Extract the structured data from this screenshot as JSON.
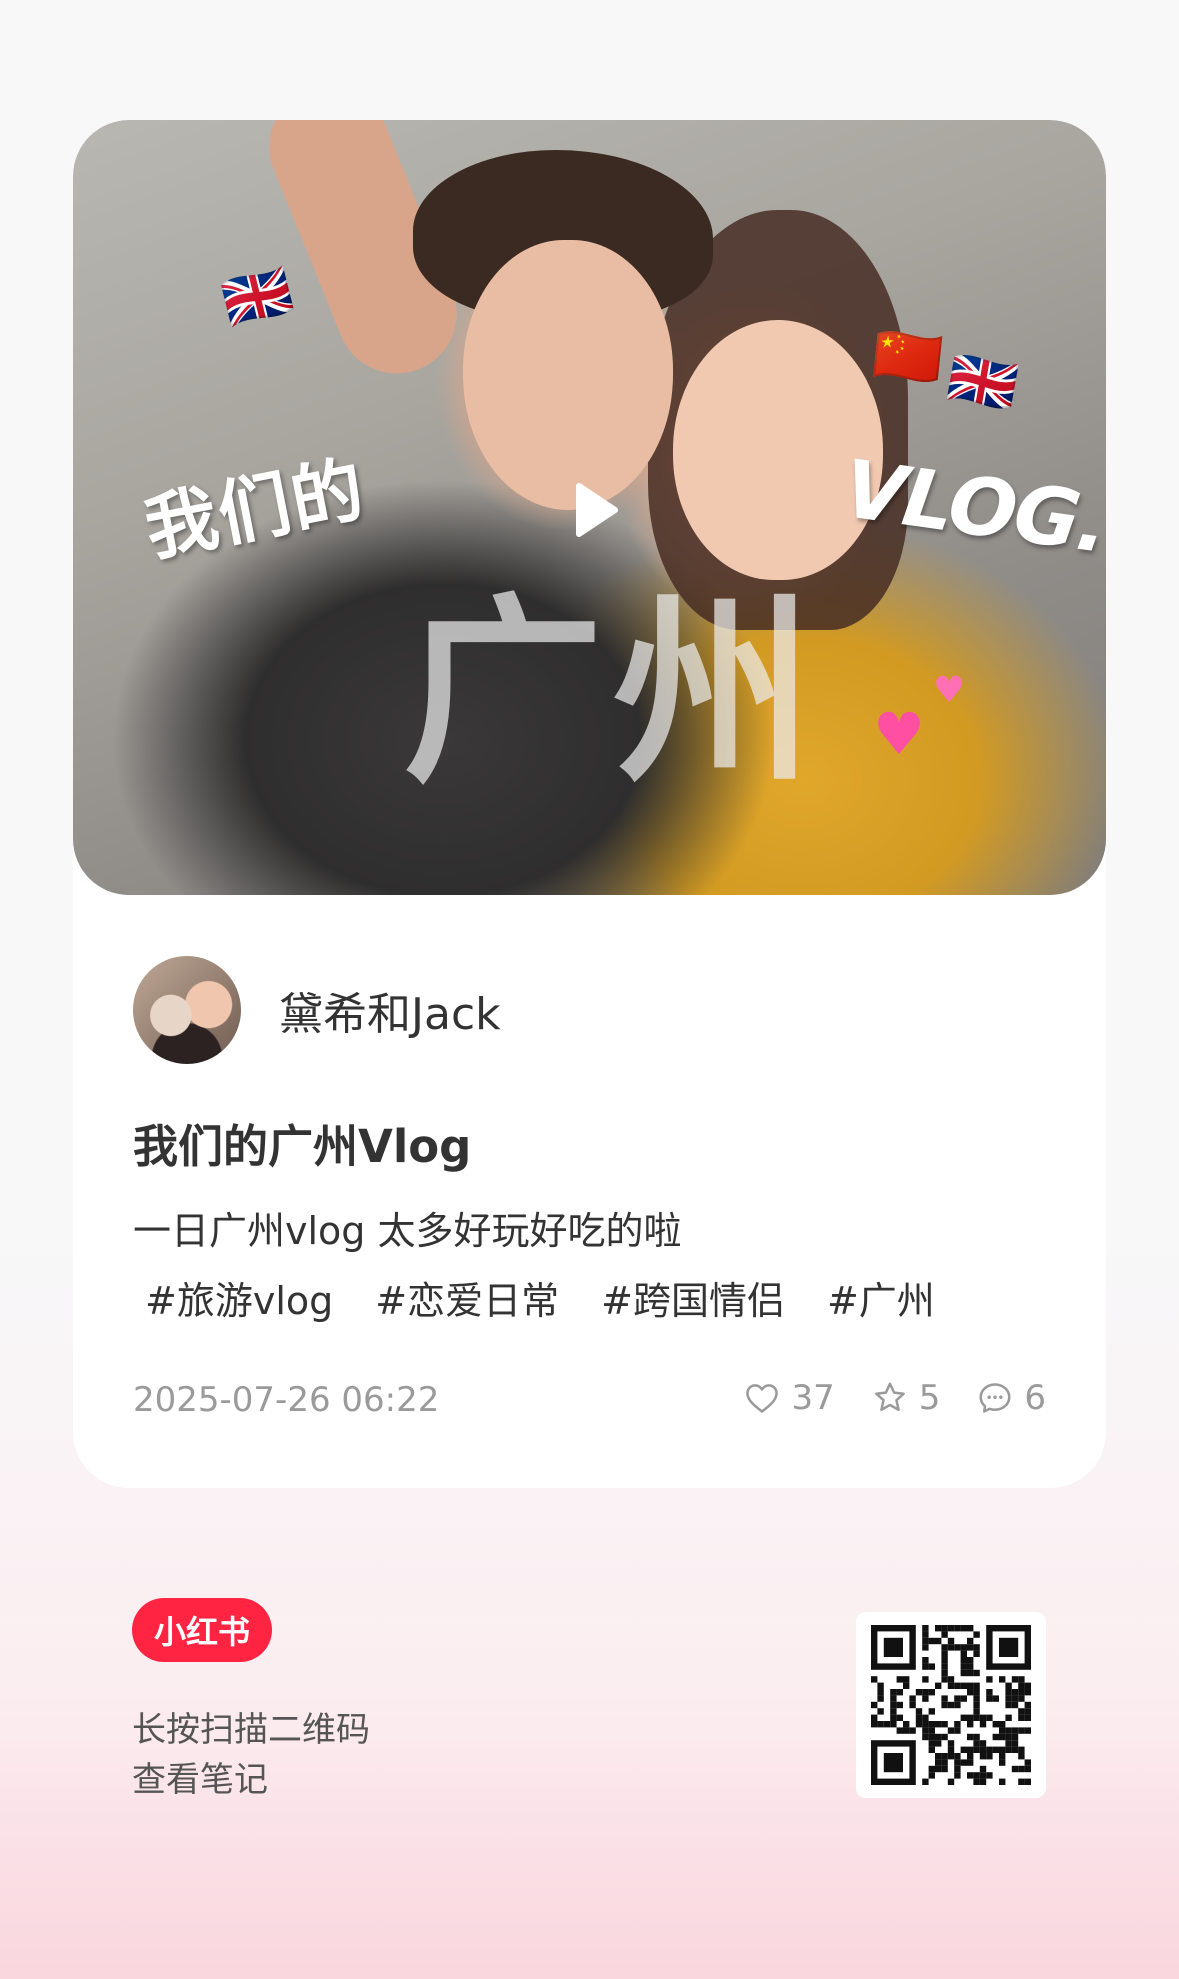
{
  "cover": {
    "text_left": "我们的",
    "text_center": "广州",
    "text_right": "VLOG.",
    "flags": [
      "🇬🇧",
      "🇨🇳",
      "🇬🇧"
    ],
    "hearts": [
      "♥",
      "♥"
    ]
  },
  "author": {
    "name": "黛希和Jack"
  },
  "post": {
    "title": "我们的广州Vlog",
    "description": "一日广州vlog 太多好玩好吃的啦",
    "tags": [
      "#旅游vlog",
      "#恋爱日常",
      "#跨国情侣",
      "#广州"
    ],
    "date": "2025-07-26 06:22"
  },
  "stats": {
    "likes": "37",
    "favorites": "5",
    "comments": "6"
  },
  "footer": {
    "brand": "小红书",
    "scan_line1": "长按扫描二维码",
    "scan_line2": "查看笔记"
  },
  "colors": {
    "brand_red": "#ff2442",
    "muted_text": "#9a9a9a",
    "card_bg": "#ffffff"
  },
  "icons": [
    "play-icon",
    "heart-icon",
    "star-icon",
    "comment-icon",
    "qr-code"
  ]
}
